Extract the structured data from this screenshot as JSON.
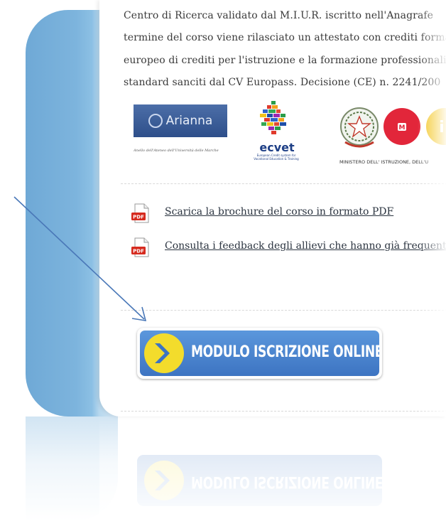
{
  "text_lines": [
    "Centro di Ricerca validato dal M.I.U.R. iscritto nell'Anagrafe",
    "termine del corso viene rilasciato un attestato con crediti forma",
    "europeo di crediti per l'istruzione e la formazione professionali (",
    "standard sanciti dal CV Europass. Decisione (CE) n. 2241/200"
  ],
  "logos": {
    "arianna": {
      "name": "Arianna",
      "subtitle": "Anello dell'Ateneo dell'Università delle Marche"
    },
    "ecvet": {
      "name": "ecvet",
      "subtitle": "European Credit system for Vocational Education & Training"
    },
    "miur": {
      "caption": "MINISTERO DELL' ISTRUZIONE, DELL'U"
    }
  },
  "links": {
    "brochure": "Scarica la brochure del corso in formato PDF",
    "feedback": "Consulta i feedback degli allievi che hanno già frequentat"
  },
  "icons": {
    "pdf_badge": "PDF",
    "miur_letter_m": "M",
    "miur_letter_i": "i"
  },
  "cta_button": {
    "label": "MODULO ISCRIZIONE ONLINE"
  },
  "colors": {
    "card_blue": "#7db4dd",
    "button_blue": "#3d74c2",
    "button_yellow": "#f3dc2c",
    "pdf_red": "#d62b1f",
    "arrow_blue": "#4a78b8",
    "miur_red": "#e2263a",
    "miur_yellow": "#f3c520"
  }
}
